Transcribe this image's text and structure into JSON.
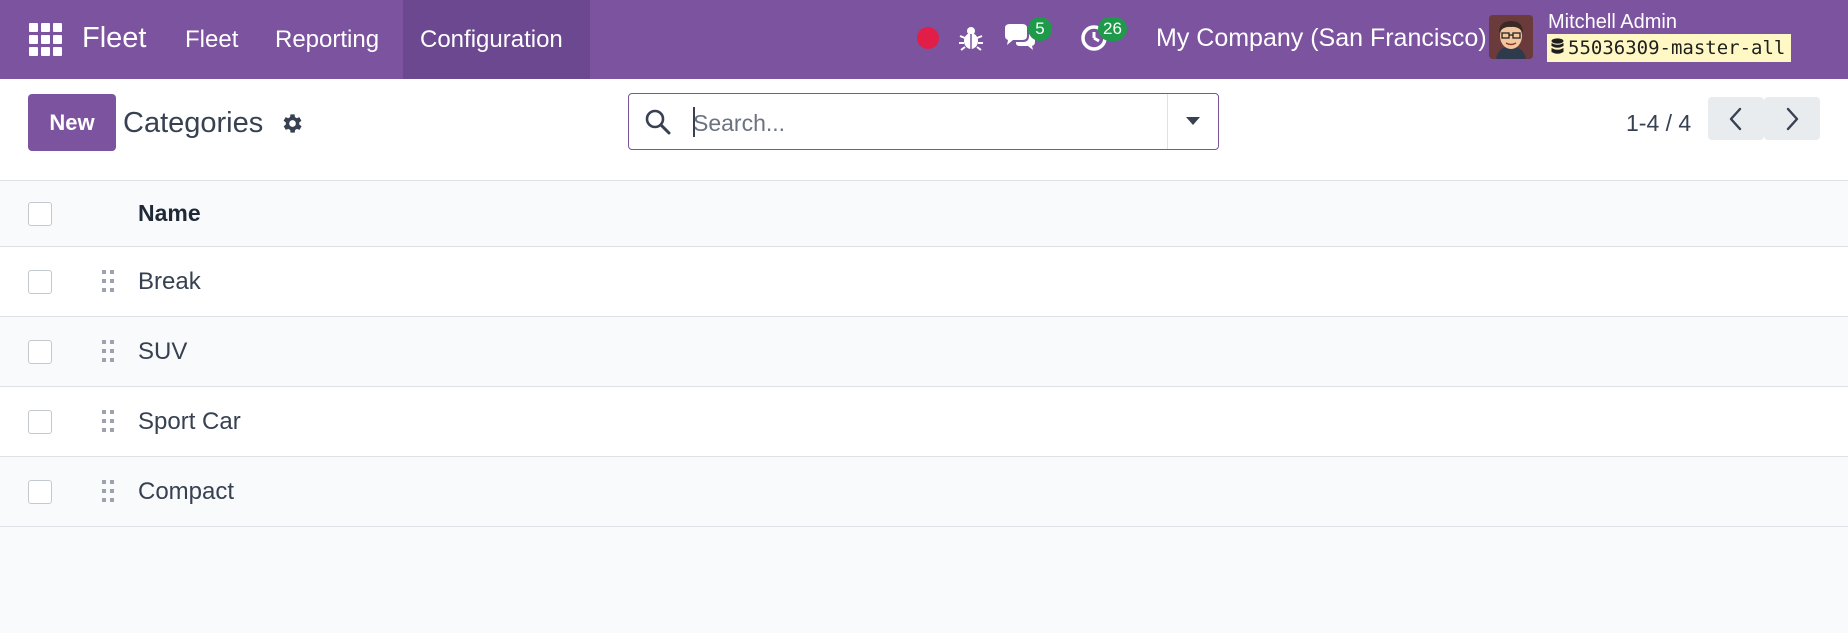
{
  "navbar": {
    "app_name": "Fleet",
    "menu": [
      {
        "label": "Fleet"
      },
      {
        "label": "Reporting"
      },
      {
        "label": "Configuration",
        "active": true
      }
    ],
    "messages_count": "5",
    "activities_count": "26",
    "company": "My Company (San Francisco)",
    "user_name": "Mitchell Admin",
    "database": "55036309-master-all"
  },
  "control_panel": {
    "new_button": "New",
    "title": "Categories",
    "search_placeholder": "Search...",
    "pager_value": "1-4 / 4"
  },
  "list": {
    "column_name": "Name",
    "rows": [
      {
        "name": "Break"
      },
      {
        "name": "SUV"
      },
      {
        "name": "Sport Car"
      },
      {
        "name": "Compact"
      }
    ]
  },
  "colors": {
    "brand": "#7c539f",
    "brand_active": "#6c4890",
    "badge": "#1e9a4a",
    "recording": "#e11d48",
    "db_tag_bg": "#fff8c5"
  },
  "icons": {
    "apps": "apps-grid-icon",
    "recording": "record-dot-icon",
    "debug": "bug-icon",
    "messages": "chat-icon",
    "activities": "clock-icon",
    "database": "database-icon",
    "settings": "gear-icon",
    "search": "search-icon",
    "toggle": "caret-down-icon",
    "previous": "chevron-left-icon",
    "next": "chevron-right-icon",
    "drag": "drag-handle-icon"
  }
}
